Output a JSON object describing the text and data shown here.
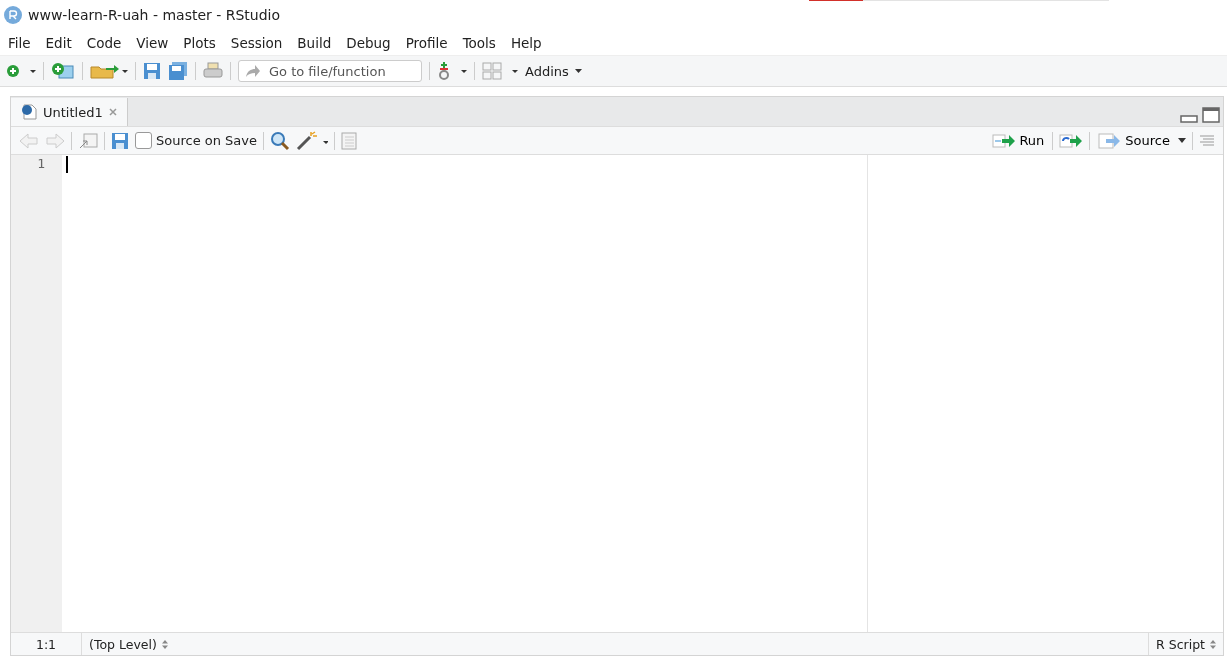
{
  "window": {
    "title": "www-learn-R-uah - master - RStudio"
  },
  "progress": {
    "level": 0.18
  },
  "menu": [
    "File",
    "Edit",
    "Code",
    "View",
    "Plots",
    "Session",
    "Build",
    "Debug",
    "Profile",
    "Tools",
    "Help"
  ],
  "toolbar": {
    "goto": {
      "placeholder": "Go to file/function"
    },
    "addins": "Addins"
  },
  "editor": {
    "tabs": [
      {
        "label": "Untitled1",
        "selected": true
      }
    ],
    "source_on_save": {
      "label": "Source on Save",
      "checked": false
    },
    "run": "Run",
    "source": "Source",
    "line_numbers": [
      "1"
    ]
  },
  "status_bar": {
    "position": "1:1",
    "scope": "(Top Level)",
    "file_type": "R Script"
  }
}
